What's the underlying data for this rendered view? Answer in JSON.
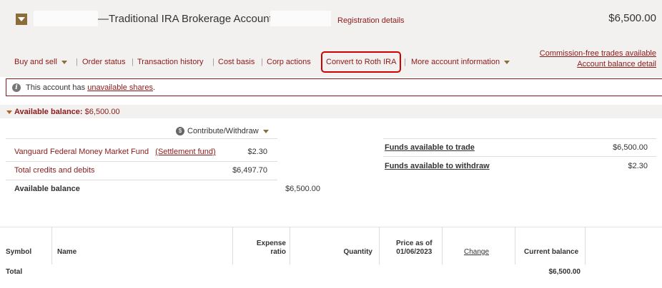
{
  "header": {
    "title_suffix": "—Traditional IRA Brokerage Account—",
    "registration_link": "Registration details",
    "balance": "$6,500.00"
  },
  "nav": {
    "items": [
      {
        "label": "Buy and sell",
        "dropdown": true
      },
      {
        "label": "Order status"
      },
      {
        "label": "Transaction history"
      },
      {
        "label": "Cost basis"
      },
      {
        "label": "Corp actions"
      },
      {
        "label": "Convert to Roth IRA",
        "highlighted": true
      },
      {
        "label": "More account information",
        "dropdown": true
      }
    ],
    "separator": "|",
    "right_links": [
      "Commission-free trades available",
      "Account balance detail"
    ]
  },
  "alert": {
    "prefix": "This account has ",
    "link": "unavailable shares",
    "suffix": "."
  },
  "available": {
    "label": "Available balance:",
    "value": "$6,500.00",
    "contribute_label": "Contribute/Withdraw",
    "rows": [
      {
        "label": "Vanguard Federal Money Market Fund",
        "link": "(Settlement fund)",
        "value": "$2.30"
      },
      {
        "label": "Total credits and debits",
        "value": "$6,497.70"
      }
    ],
    "total_label": "Available balance",
    "total_value": "$6,500.00",
    "funds": [
      {
        "label": "Funds available to trade",
        "value": "$6,500.00"
      },
      {
        "label": "Funds available to withdraw",
        "value": "$2.30"
      }
    ]
  },
  "holdings": {
    "headers": {
      "symbol": "Symbol",
      "name": "Name",
      "expense_1": "Expense",
      "expense_2": "ratio",
      "quantity": "Quantity",
      "price_1": "Price as of",
      "price_2": "01/06/2023",
      "change": "Change",
      "current_balance": "Current balance"
    },
    "total_label": "Total",
    "total_value": "$6,500.00"
  },
  "colors": {
    "accent": "#8a1a1a",
    "highlight": "#d00000",
    "icon_brown": "#8a6d3b"
  },
  "icons": [
    "caret-down-icon",
    "info-icon",
    "contribute-icon"
  ]
}
